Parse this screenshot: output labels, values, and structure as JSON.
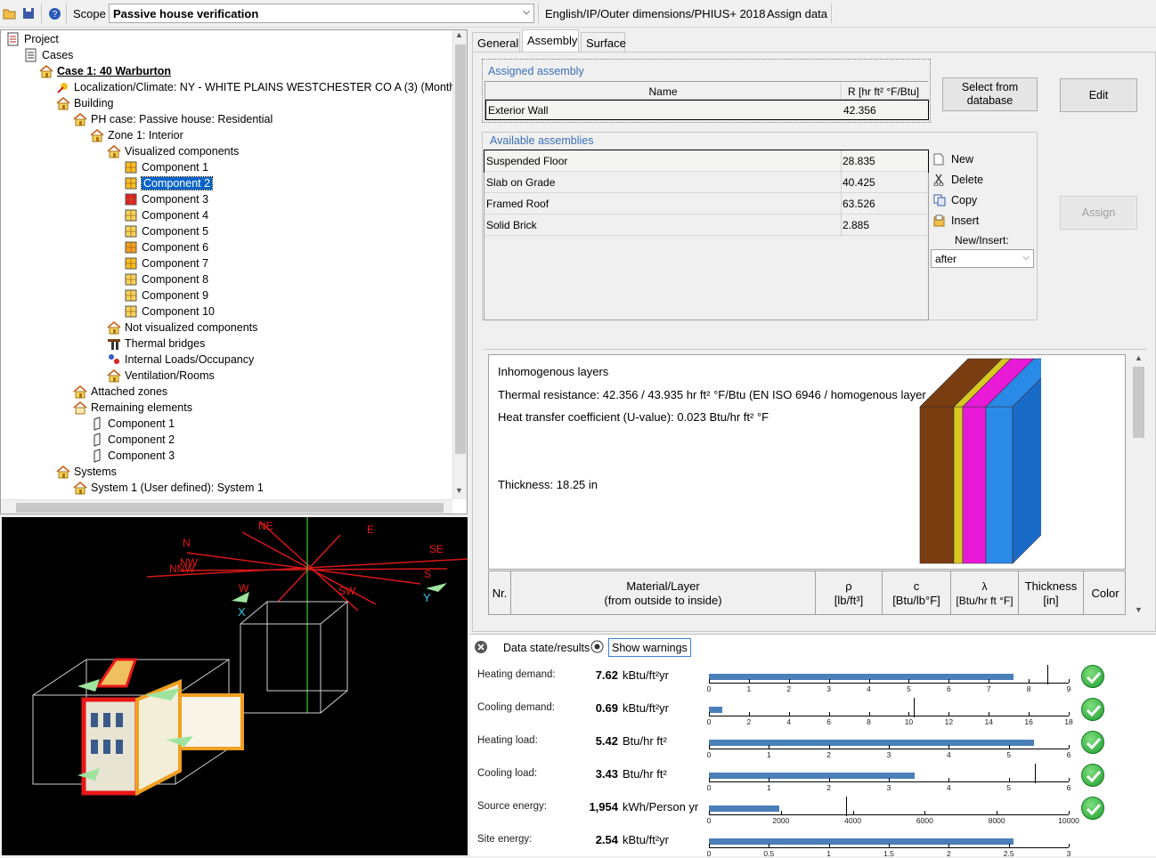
{
  "toolbar": {
    "scope_label": "Scope",
    "scope_value": "Passive house verification",
    "units_label": "English/IP/Outer dimensions/PHIUS+ 2018",
    "assign_data_label": "Assign data"
  },
  "tree": {
    "items": [
      {
        "label": "Project"
      },
      {
        "label": "Cases"
      },
      {
        "label": "Case 1: 40 Warburton"
      },
      {
        "label": "Localization/Climate: NY - WHITE PLAINS WESTCHESTER CO A  (3) (Monthly)"
      },
      {
        "label": "Building"
      },
      {
        "label": "PH case: Passive house: Residential"
      },
      {
        "label": "Zone 1: Interior"
      },
      {
        "label": "Visualized components"
      },
      {
        "label": "Component 1"
      },
      {
        "label": "Component 2"
      },
      {
        "label": "Component 3"
      },
      {
        "label": "Component 4"
      },
      {
        "label": "Component 5"
      },
      {
        "label": "Component 6"
      },
      {
        "label": "Component 7"
      },
      {
        "label": "Component 8"
      },
      {
        "label": "Component 9"
      },
      {
        "label": "Component 10"
      },
      {
        "label": "Not visualized components"
      },
      {
        "label": "Thermal bridges"
      },
      {
        "label": "Internal Loads/Occupancy"
      },
      {
        "label": "Ventilation/Rooms"
      },
      {
        "label": "Attached zones"
      },
      {
        "label": "Remaining elements"
      },
      {
        "label": "Component 1"
      },
      {
        "label": "Component 2"
      },
      {
        "label": "Component 3"
      },
      {
        "label": "Systems"
      },
      {
        "label": "System 1 (User defined): System 1"
      }
    ]
  },
  "view3d": {
    "compass": [
      "N",
      "NE",
      "E",
      "SE",
      "S",
      "SW",
      "W",
      "NW",
      "NNW"
    ],
    "axis_labels": [
      "X",
      "Y"
    ]
  },
  "tabs": [
    "General",
    "Assembly",
    "Surface"
  ],
  "assigned": {
    "title": "Assigned assembly",
    "col_name": "Name",
    "col_r": "R [hr ft² °F/Btu]",
    "row": {
      "name": "Exterior Wall",
      "r": "42.356"
    }
  },
  "buttons": {
    "select_db": "Select from database",
    "edit": "Edit",
    "assign": "Assign"
  },
  "available": {
    "title": "Available assemblies",
    "rows": [
      {
        "name": "Suspended Floor",
        "r": "28.835"
      },
      {
        "name": "Slab on Grade",
        "r": "40.425"
      },
      {
        "name": "Framed Roof",
        "r": "63.526"
      },
      {
        "name": "Solid Brick",
        "r": "2.885"
      }
    ]
  },
  "side_actions": {
    "new": "New",
    "delete": "Delete",
    "copy": "Copy",
    "insert": "Insert",
    "new_insert_label": "New/Insert:",
    "position_value": "after"
  },
  "info": {
    "l1": "Inhomogenous layers",
    "l2": "Thermal resistance: 42.356 / 43.935 hr ft² °F/Btu (EN ISO 6946 / homogenous layer",
    "l3": "Heat transfer coefficient (U-value): 0.023 Btu/hr ft² °F",
    "l4": "Thickness: 18.25  in",
    "layer_colors": [
      "#7a3d10",
      "#d8c820",
      "#e81ad8",
      "#2a8ae8"
    ]
  },
  "layer_table": {
    "nr": "Nr.",
    "material_l1": "Material/Layer",
    "material_l2": "(from outside to inside)",
    "rho_l1": "ρ",
    "rho_l2": "[lb/ft³]",
    "c_l1": "c",
    "c_l2": "[Btu/lb°F]",
    "lambda_l1": "λ",
    "lambda_l2": "[Btu/hr ft °F]",
    "thick_l1": "Thickness",
    "thick_l2": "[in]",
    "color": "Color"
  },
  "results": {
    "header_label": "Data state/results",
    "show_warnings": "Show warnings",
    "rows": [
      {
        "label": "Heating demand:",
        "value": "7.62",
        "unit": "kBtu/ft²yr",
        "fraction": 0.847,
        "limit": 0.94,
        "ticks": [
          "0",
          "1",
          "2",
          "3",
          "4",
          "5",
          "6",
          "7",
          "8",
          "9"
        ],
        "ok": true
      },
      {
        "label": "Cooling demand:",
        "value": "0.69",
        "unit": "kBtu/ft²yr",
        "fraction": 0.038,
        "limit": 0.57,
        "ticks": [
          "0",
          "2",
          "4",
          "6",
          "8",
          "10",
          "12",
          "14",
          "16",
          "18"
        ],
        "ok": true
      },
      {
        "label": "Heating load:",
        "value": "5.42",
        "unit": "Btu/hr ft²",
        "fraction": 0.903,
        "limit": null,
        "ticks": [
          "0",
          "1",
          "2",
          "3",
          "4",
          "5",
          "6"
        ],
        "ok": true
      },
      {
        "label": "Cooling load:",
        "value": "3.43",
        "unit": "Btu/hr ft²",
        "fraction": 0.572,
        "limit": 0.905,
        "ticks": [
          "0",
          "1",
          "2",
          "3",
          "4",
          "5",
          "6"
        ],
        "ok": true
      },
      {
        "label": "Source energy:",
        "value": "1,954",
        "unit": "kWh/Person yr",
        "fraction": 0.195,
        "limit": 0.38,
        "ticks": [
          "0",
          "2000",
          "4000",
          "6000",
          "8000",
          "10000"
        ],
        "ok": true
      },
      {
        "label": "Site energy:",
        "value": "2.54",
        "unit": "kBtu/ft²yr",
        "fraction": 0.847,
        "limit": null,
        "ticks": [
          "0",
          "0.5",
          "1",
          "1.5",
          "2",
          "2.5",
          "3"
        ],
        "ok": null
      }
    ]
  }
}
